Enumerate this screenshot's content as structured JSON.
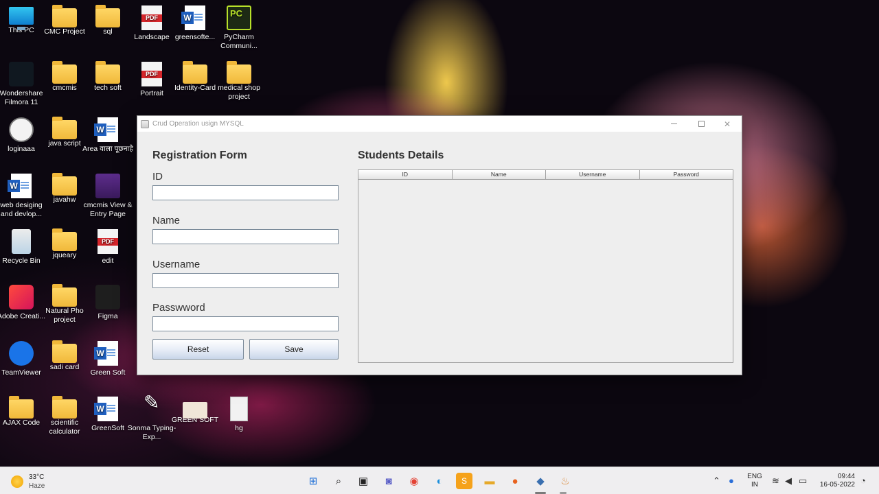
{
  "desktop": {
    "icons": [
      {
        "label": "This PC"
      },
      {
        "label": "CMC Project"
      },
      {
        "label": "sql"
      },
      {
        "label": "Landscape"
      },
      {
        "label": "greensofte..."
      },
      {
        "label": "PyCharm Communi..."
      },
      {
        "label": "Wondershare Filmora 11"
      },
      {
        "label": "cmcmis"
      },
      {
        "label": "tech soft"
      },
      {
        "label": "Portrait"
      },
      {
        "label": "Identity-Card"
      },
      {
        "label": "medical shop project"
      },
      {
        "label": "loginaaa"
      },
      {
        "label": "java script"
      },
      {
        "label": "Area वाला पूछनाहै"
      },
      {
        "label": "web desiging and devlop..."
      },
      {
        "label": "javahw"
      },
      {
        "label": "cmcmis View & Entry Page"
      },
      {
        "label": "Recycle Bin"
      },
      {
        "label": "jqueary"
      },
      {
        "label": "edit"
      },
      {
        "label": "Adobe Creati..."
      },
      {
        "label": "Natural Pho project"
      },
      {
        "label": "Figma"
      },
      {
        "label": "TeamViewer"
      },
      {
        "label": "sadi card"
      },
      {
        "label": "Green Soft"
      },
      {
        "label": "AJAX Code"
      },
      {
        "label": "scientific calculator"
      },
      {
        "label": "GreenSoft"
      },
      {
        "label": "Sonma Typing-Exp..."
      },
      {
        "label": "GREEN SOFT"
      },
      {
        "label": "hg"
      }
    ]
  },
  "window": {
    "title": "Crud Operation usign MYSQL",
    "form": {
      "heading": "Registration Form",
      "id_label": "ID",
      "id_value": "",
      "name_label": "Name",
      "name_value": "",
      "username_label": "Username",
      "username_value": "",
      "password_label": "Passwword",
      "password_value": "",
      "reset_label": "Reset",
      "save_label": "Save"
    },
    "details": {
      "heading": "Students Details",
      "columns": [
        "ID",
        "Name",
        "Username",
        "Password"
      ]
    }
  },
  "taskbar": {
    "weather_temp": "33°C",
    "weather_cond": "Haze",
    "lang_top": "ENG",
    "lang_bottom": "IN",
    "time": "09:44",
    "date": "16-05-2022"
  }
}
